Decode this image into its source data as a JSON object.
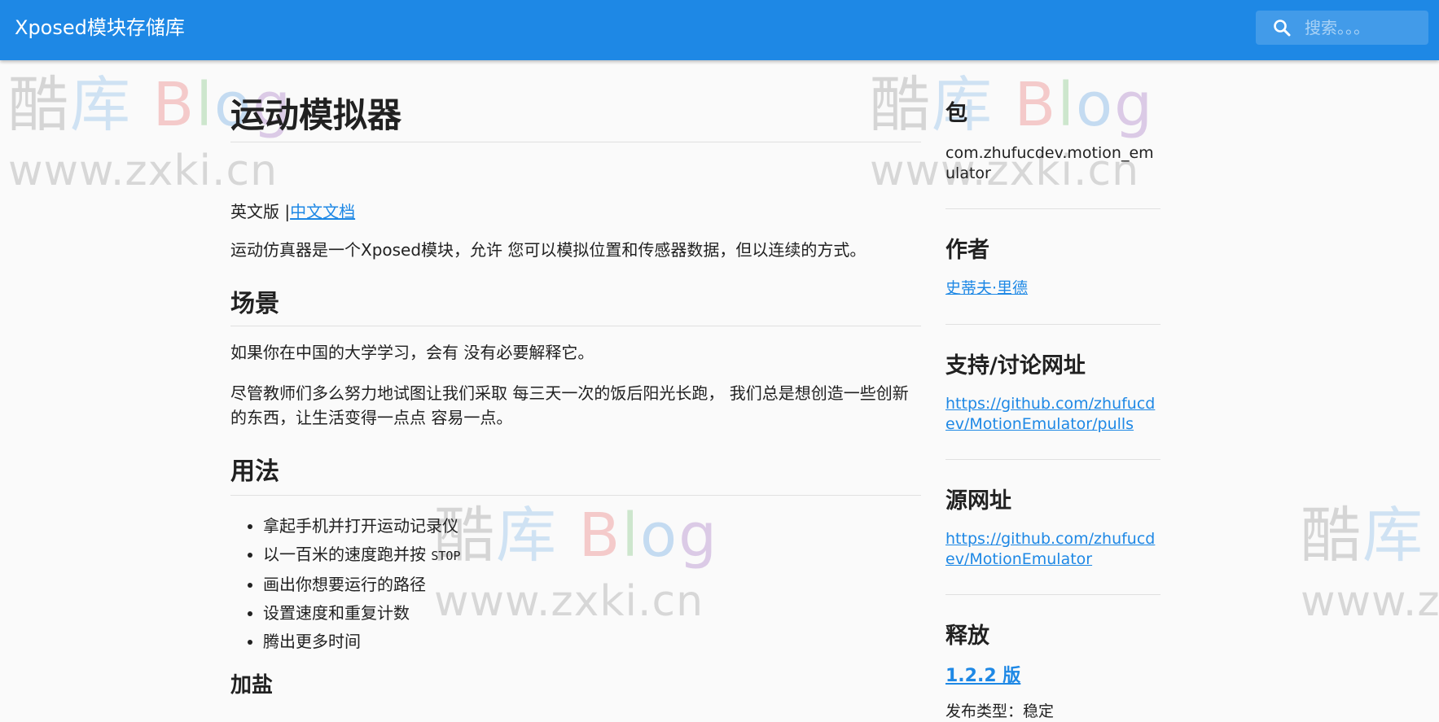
{
  "header": {
    "brand": "Xposed模块存储库",
    "search_placeholder": "搜索。。。"
  },
  "watermark": {
    "chars_cn": "酷库",
    "blog": "Blog",
    "url": "www.zxki.cn"
  },
  "article": {
    "title": "运动模拟器",
    "lang_en": "英文版 |",
    "lang_cn_link": "中文文档",
    "intro": "运动仿真器是一个Xposed模块，允许 您可以模拟位置和传感器数据，但以连续的方式。",
    "section_scene": "场景",
    "scene_p1": "如果你在中国的大学学习，会有 没有必要解释它。",
    "scene_p2": "尽管教师们多么努力地试图让我们采取 每三天一次的饭后阳光长跑， 我们总是想创造一些创新的东西，让生活变得一点点 容易一点。",
    "section_usage": "用法",
    "usage_items": [
      "拿起手机并打开运动记录仪",
      "以一百米的速度跑并按",
      "画出你想要运行的路径",
      "设置速度和重复计数",
      "腾出更多时间"
    ],
    "stop_code": "STOP",
    "section_salt": "加盐"
  },
  "sidebar": {
    "package_heading": "包",
    "package_value": "com.zhufucdev.motion_emulator",
    "author_heading": "作者",
    "author_link": "史蒂夫·里德",
    "support_heading": "支持/讨论网址",
    "support_link": "https://github.com/zhufucdev/MotionEmulator/pulls",
    "source_heading": "源网址",
    "source_link": "https://github.com/zhufucdev/MotionEmulator",
    "release_heading": "释放",
    "release_link": "1.2.2 版",
    "release_type": "发布类型：稳定"
  },
  "colors": {
    "appbar": "#1e88e5",
    "link": "#1e88e5",
    "background": "#fafafa",
    "text": "#212121"
  }
}
